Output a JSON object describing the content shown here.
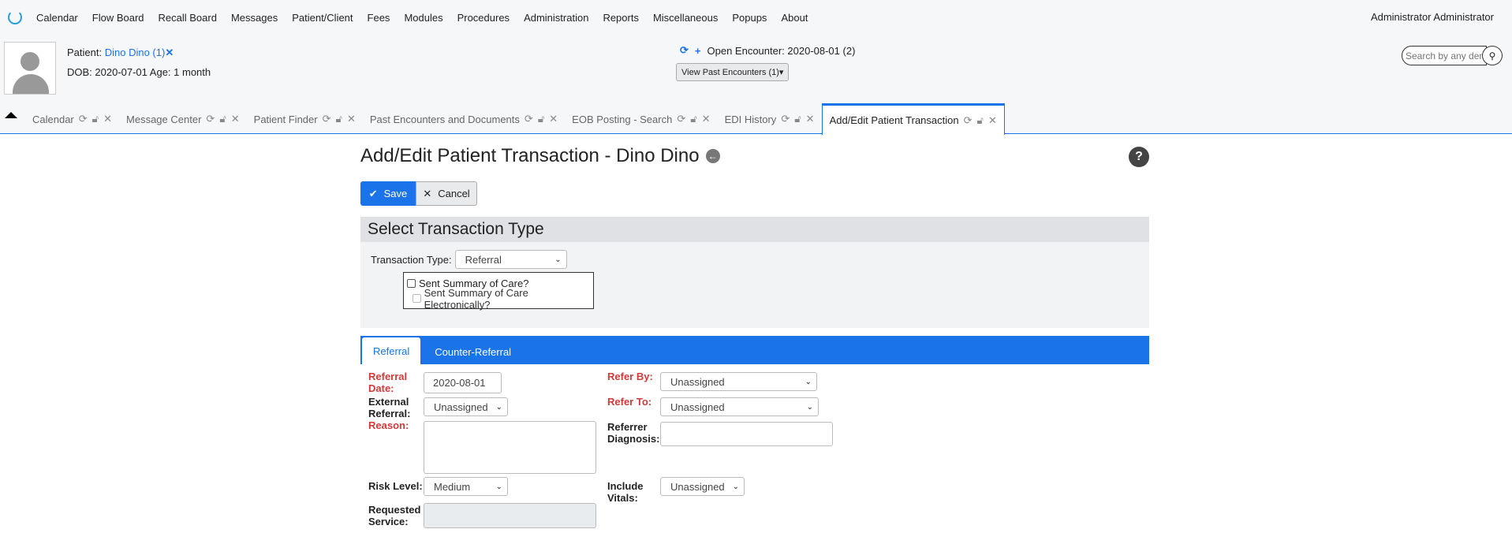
{
  "menu": [
    "Calendar",
    "Flow Board",
    "Recall Board",
    "Messages",
    "Patient/Client",
    "Fees",
    "Modules",
    "Procedures",
    "Administration",
    "Reports",
    "Miscellaneous",
    "Popups",
    "About"
  ],
  "user": "Administrator Administrator",
  "patient": {
    "label": "Patient:",
    "name": "Dino Dino (1)",
    "dob_line": "DOB: 2020-07-01 Age: 1 month"
  },
  "encounter": {
    "open_text": "Open Encounter: 2020-08-01 (2)",
    "view_past": "View Past Encounters  (1)"
  },
  "search": {
    "placeholder": "Search by any demographics"
  },
  "tabs": [
    {
      "label": "Calendar",
      "active": false
    },
    {
      "label": "Message Center",
      "active": false
    },
    {
      "label": "Patient Finder",
      "active": false
    },
    {
      "label": "Past Encounters and Documents",
      "active": false
    },
    {
      "label": "EOB Posting - Search",
      "active": false
    },
    {
      "label": "EDI History",
      "active": false
    },
    {
      "label": "Add/Edit Patient Transaction",
      "active": true
    }
  ],
  "page": {
    "title": "Add/Edit Patient Transaction - Dino Dino",
    "save": "Save",
    "cancel": "Cancel"
  },
  "transaction": {
    "heading": "Select Transaction Type",
    "type_label": "Transaction Type:",
    "type_value": "Referral",
    "sent_summary": "Sent Summary of Care?",
    "sent_summary_elec": "Sent Summary of Care Electronically?"
  },
  "subtabs": [
    "Referral",
    "Counter-Referral"
  ],
  "form": {
    "referral_date_label": "Referral Date:",
    "referral_date_value": "2020-08-01",
    "external_referral_label": "External Referral:",
    "external_referral_value": "Unassigned",
    "reason_label": "Reason:",
    "risk_level_label": "Risk Level:",
    "risk_level_value": "Medium",
    "requested_service_label": "Requested Service:",
    "refer_by_label": "Refer By:",
    "refer_by_value": "Unassigned",
    "refer_to_label": "Refer To:",
    "refer_to_value": "Unassigned",
    "referrer_diagnosis_label": "Referrer Diagnosis:",
    "include_vitals_label": "Include Vitals:",
    "include_vitals_value": "Unassigned"
  }
}
